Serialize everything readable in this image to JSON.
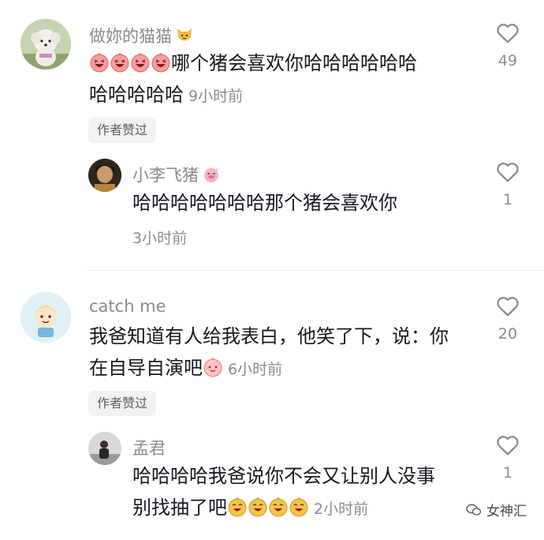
{
  "comments": [
    {
      "user": "做妳的猫猫",
      "text_line1": "哪个猪会喜欢你哈哈哈哈哈哈",
      "text_line2": "哈哈哈哈哈",
      "time": "9小时前",
      "likes": "49",
      "badge": "作者赞过",
      "reply": {
        "user": "小李飞猪",
        "text": "哈哈哈哈哈哈哈那个猪会喜欢你",
        "time": "3小时前",
        "likes": "1"
      }
    },
    {
      "user": "catch me",
      "text_line1": "我爸知道有人给我表白，他笑了下，说：你",
      "text_line2": "在自导自演吧",
      "time": "6小时前",
      "likes": "20",
      "badge": "作者赞过",
      "reply": {
        "user": "孟君",
        "text_line1": "哈哈哈哈我爸说你不会又让别人没事",
        "text_line2": "别找抽了吧",
        "time": "2小时前",
        "likes": "1"
      }
    }
  ],
  "watermark": "女神汇",
  "icons": {
    "like": "heart-outline-icon",
    "emoji_laugh": "pink-laughing-face-emoji",
    "emoji_shy": "pink-smile-face-emoji",
    "emoji_cat": "cat-face-emoji",
    "emoji_pig": "pig-face-emoji",
    "emoji_orange": "yellow-grin-face-emoji",
    "watermark": "wechat-icon"
  }
}
